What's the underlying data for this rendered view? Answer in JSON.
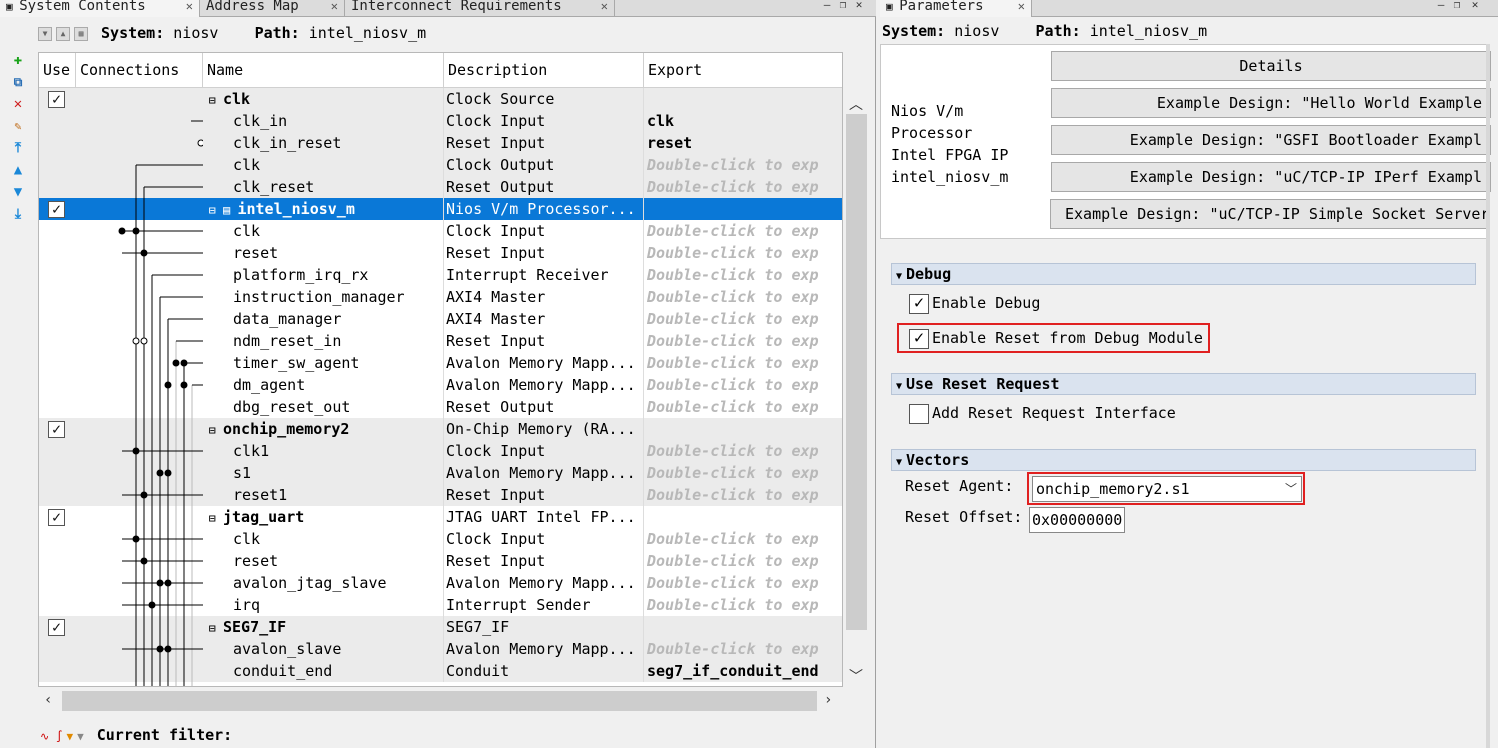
{
  "left_tabs": [
    {
      "label": "System Contents"
    },
    {
      "label": "Address Map"
    },
    {
      "label": "Interconnect Requirements"
    }
  ],
  "left_header": {
    "system_label": "System:",
    "system_value": "niosv",
    "path_label": "Path:",
    "path_value": "intel_niosv_m"
  },
  "columns": {
    "use": "Use",
    "connections": "Connections",
    "name": "Name",
    "description": "Description",
    "export": "Export"
  },
  "export_hint": "Double-click to exp",
  "rows": [
    {
      "name": "clk",
      "desc": "Clock Source",
      "export": "",
      "module": true
    },
    {
      "name": "clk_in",
      "desc": "Clock Input",
      "export": "clk"
    },
    {
      "name": "clk_in_reset",
      "desc": "Reset Input",
      "export": "reset"
    },
    {
      "name": "clk",
      "desc": "Clock Output",
      "export": "hint"
    },
    {
      "name": "clk_reset",
      "desc": "Reset Output",
      "export": "hint"
    },
    {
      "name": "intel_niosv_m",
      "desc": "Nios V/m Processor...",
      "export": "",
      "module": true,
      "selected": true
    },
    {
      "name": "clk",
      "desc": "Clock Input",
      "export": "hint"
    },
    {
      "name": "reset",
      "desc": "Reset Input",
      "export": "hint"
    },
    {
      "name": "platform_irq_rx",
      "desc": "Interrupt Receiver",
      "export": "hint"
    },
    {
      "name": "instruction_manager",
      "desc": "AXI4 Master",
      "export": "hint"
    },
    {
      "name": "data_manager",
      "desc": "AXI4 Master",
      "export": "hint"
    },
    {
      "name": "ndm_reset_in",
      "desc": "Reset Input",
      "export": "hint"
    },
    {
      "name": "timer_sw_agent",
      "desc": "Avalon Memory Mapp...",
      "export": "hint"
    },
    {
      "name": "dm_agent",
      "desc": "Avalon Memory Mapp...",
      "export": "hint"
    },
    {
      "name": "dbg_reset_out",
      "desc": "Reset Output",
      "export": "hint"
    },
    {
      "name": "onchip_memory2",
      "desc": "On-Chip Memory (RA...",
      "export": "",
      "module": true
    },
    {
      "name": "clk1",
      "desc": "Clock Input",
      "export": "hint"
    },
    {
      "name": "s1",
      "desc": "Avalon Memory Mapp...",
      "export": "hint"
    },
    {
      "name": "reset1",
      "desc": "Reset Input",
      "export": "hint"
    },
    {
      "name": "jtag_uart",
      "desc": "JTAG UART Intel FP...",
      "export": "",
      "module": true
    },
    {
      "name": "clk",
      "desc": "Clock Input",
      "export": "hint"
    },
    {
      "name": "reset",
      "desc": "Reset Input",
      "export": "hint"
    },
    {
      "name": "avalon_jtag_slave",
      "desc": "Avalon Memory Mapp...",
      "export": "hint"
    },
    {
      "name": "irq",
      "desc": "Interrupt Sender",
      "export": "hint"
    },
    {
      "name": "SEG7_IF",
      "desc": "SEG7_IF",
      "export": "",
      "module": true
    },
    {
      "name": "avalon_slave",
      "desc": "Avalon Memory Mapp...",
      "export": "hint"
    },
    {
      "name": "conduit_end",
      "desc": "Conduit",
      "export": "seg7_if_conduit_end"
    }
  ],
  "filter": {
    "label": "Current filter:"
  },
  "right_tab": {
    "label": "Parameters"
  },
  "right_header": {
    "system_label": "System:",
    "system_value": "niosv",
    "path_label": "Path:",
    "path_value": "intel_niosv_m"
  },
  "info": {
    "line1": "Nios V/m",
    "line2": "Processor",
    "line3": "Intel FPGA IP",
    "line4": "intel_niosv_m"
  },
  "buttons": {
    "details": "Details",
    "ex1": "Example Design: \"Hello World Example",
    "ex2": "Example Design: \"GSFI Bootloader Exampl",
    "ex3": "Example Design: \"uC/TCP-IP IPerf Exampl",
    "ex4": "Example Design: \"uC/TCP-IP Simple Socket Server"
  },
  "debug": {
    "title": "Debug",
    "enable_debug": "Enable Debug",
    "enable_reset": "Enable Reset from Debug Module"
  },
  "reset_request": {
    "title": "Use Reset Request",
    "add_interface": "Add Reset Request Interface"
  },
  "vectors": {
    "title": "Vectors",
    "reset_agent_label": "Reset Agent:",
    "reset_agent_value": "onchip_memory2.s1",
    "reset_offset_label": "Reset Offset:",
    "reset_offset_value": "0x00000000"
  },
  "colors": {
    "selection": "#0a78d7",
    "highlight_border": "#e02020",
    "section_bg": "#dae3ef"
  }
}
